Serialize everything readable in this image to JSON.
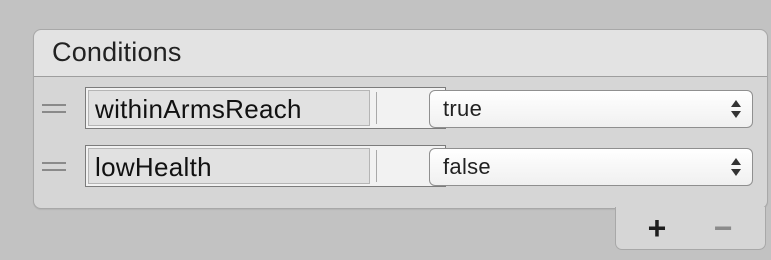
{
  "panel": {
    "title": "Conditions"
  },
  "conditions": [
    {
      "variable": "withinArmsReach",
      "value": "true"
    },
    {
      "variable": "lowHealth",
      "value": "false"
    }
  ],
  "footer": {
    "add_label": "+",
    "remove_label": "−"
  },
  "icons": {
    "drag": "drag-handle-icon",
    "dropdown": "chevron-down-icon",
    "stepper": "up-down-stepper-icon",
    "add": "plus-icon",
    "remove": "minus-icon"
  }
}
